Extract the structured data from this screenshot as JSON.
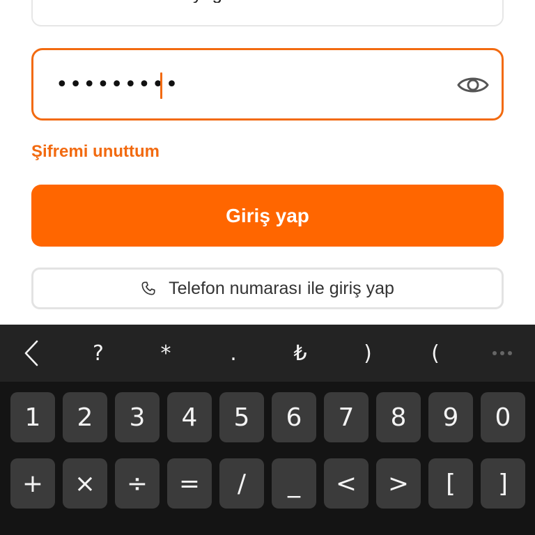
{
  "previous_field": {
    "partial_text": "yng"
  },
  "password_field": {
    "value": "•••••••••",
    "toggle_icon": "eye-icon"
  },
  "forgot_link": {
    "label": "Şifremi unuttum"
  },
  "login_button": {
    "label": "Giriş yap"
  },
  "phone_login_button": {
    "label": "Telefon numarası ile giriş yap",
    "icon": "phone-icon"
  },
  "colors": {
    "accent": "#ff6600",
    "accent_border": "#f26a10",
    "keyboard_bg": "#141414",
    "key_bg": "#3b3b3b"
  },
  "keyboard": {
    "toolbar": {
      "back_icon": "chevron-left-icon",
      "keys": [
        "?",
        "*",
        ".",
        "₺",
        ")",
        "("
      ],
      "more_icon": "more-icon"
    },
    "rows": [
      [
        "1",
        "2",
        "3",
        "4",
        "5",
        "6",
        "7",
        "8",
        "9",
        "0"
      ],
      [
        "+",
        "×",
        "÷",
        "=",
        "/",
        "_",
        "<",
        ">",
        "[",
        "]"
      ]
    ]
  }
}
